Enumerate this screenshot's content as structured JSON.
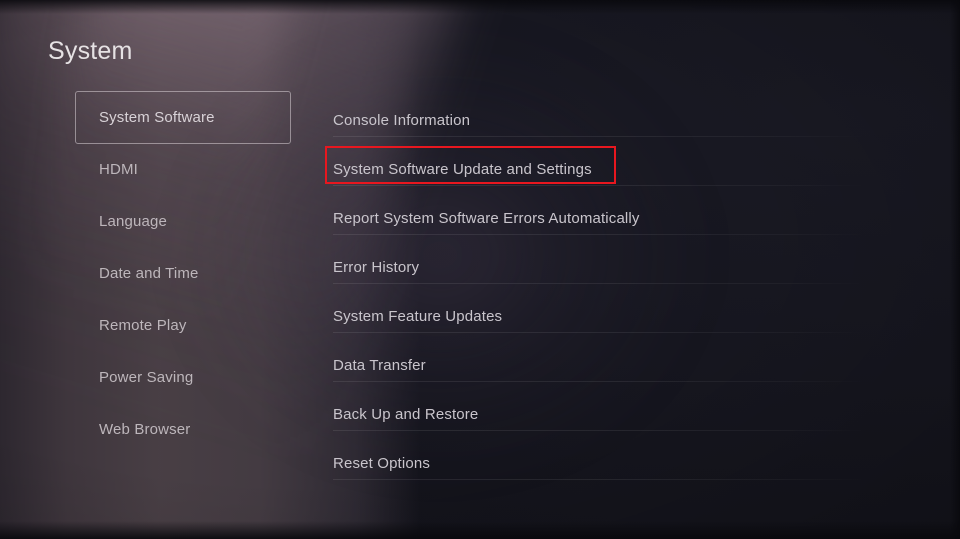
{
  "header": {
    "title": "System"
  },
  "sidebar": {
    "selected_index": 0,
    "items": [
      {
        "label": "System Software"
      },
      {
        "label": "HDMI"
      },
      {
        "label": "Language"
      },
      {
        "label": "Date and Time"
      },
      {
        "label": "Remote Play"
      },
      {
        "label": "Power Saving"
      },
      {
        "label": "Web Browser"
      }
    ]
  },
  "main": {
    "items": [
      {
        "label": "Console Information"
      },
      {
        "label": "System Software Update and Settings"
      },
      {
        "label": "Report System Software Errors Automatically"
      },
      {
        "label": "Error History"
      },
      {
        "label": "System Feature Updates"
      },
      {
        "label": "Data Transfer"
      },
      {
        "label": "Back Up and Restore"
      },
      {
        "label": "Reset Options"
      }
    ],
    "highlighted_index": 1
  },
  "annotation": {
    "highlight_color": "#e8171f",
    "target_label": "System Software Update and Settings"
  },
  "colors": {
    "background_dark": "#16161f",
    "background_mauve": "#4a4046",
    "text_primary": "#d8d2d7",
    "text_secondary": "#bdb6bb",
    "selection_border": "#d8d0d6"
  }
}
